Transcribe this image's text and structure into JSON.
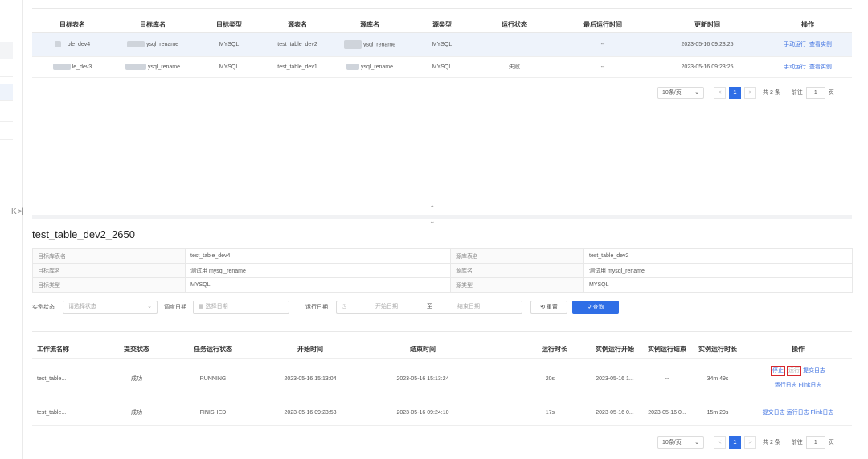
{
  "top_table": {
    "headers": [
      "目标表名",
      "目标库名",
      "目标类型",
      "源表名",
      "源库名",
      "源类型",
      "运行状态",
      "最后运行时间",
      "更新时间",
      "操作"
    ],
    "rows": [
      {
        "target_table": "ble_dev4",
        "target_db": "ysql_rename",
        "target_type": "MYSQL",
        "source_table": "test_table_dev2",
        "source_db": "ysql_rename",
        "source_type": "MYSQL",
        "status": "",
        "last_run": "--",
        "updated": "2023-05-16 09:23:25",
        "action1": "手动运行",
        "action2": "查看实例"
      },
      {
        "target_table": "le_dev3",
        "target_db": "ysql_rename",
        "target_type": "MYSQL",
        "source_table": "test_table_dev1",
        "source_db": "ysql_rename",
        "source_type": "MYSQL",
        "status": "失败",
        "last_run": "--",
        "updated": "2023-05-16 09:23:25",
        "action1": "手动运行",
        "action2": "查看实例"
      }
    ],
    "pager": {
      "page_size": "10条/页",
      "current": "1",
      "total": "共 2 条",
      "goto_label": "前往",
      "goto_value": "1",
      "page_label": "页"
    }
  },
  "collapse_icon": "K >|",
  "splitter": {
    "up": "⌃",
    "down": "⌄"
  },
  "detail": {
    "title": "test_table_dev2_2650",
    "info": [
      {
        "k1": "目标库表名",
        "v1": "test_table_dev4",
        "k2": "源库表名",
        "v2": "test_table_dev2"
      },
      {
        "k1": "目标库名",
        "v1": "测试用 mysql_rename",
        "k2": "源库名",
        "v2": "测试用 mysql_rename"
      },
      {
        "k1": "目标类型",
        "v1": "MYSQL",
        "k2": "源类型",
        "v2": "MYSQL"
      }
    ],
    "filters": {
      "status_label": "实例状态",
      "status_placeholder": "请选择状态",
      "schedule_label": "调度日期",
      "schedule_placeholder": "选择日期",
      "run_label": "运行日期",
      "run_start": "开始日期",
      "run_sep": "至",
      "run_end": "结束日期",
      "reset": "重置",
      "query": "查询"
    },
    "runs_table": {
      "headers": [
        "工作流名称",
        "提交状态",
        "任务运行状态",
        "开始时间",
        "结束时间",
        "运行时长",
        "实例运行开始",
        "实例运行结束",
        "实例运行时长",
        "操作"
      ],
      "rows": [
        {
          "name": "test_table...",
          "submit": "成功",
          "state": "RUNNING",
          "start": "2023-05-16 15:13:04",
          "end": "2023-05-16 15:13:24",
          "duration": "20s",
          "inst_start": "2023-05-16 1...",
          "inst_end": "--",
          "inst_dur": "34m 49s",
          "a_stop": "停止",
          "a_run": "运行",
          "a_submit_log": "提交日志",
          "a_run_log": "运行日志",
          "a_flink_log": "Flink日志"
        },
        {
          "name": "test_table...",
          "submit": "成功",
          "state": "FINISHED",
          "start": "2023-05-16 09:23:53",
          "end": "2023-05-16 09:24:10",
          "duration": "17s",
          "inst_start": "2023-05-16 0...",
          "inst_end": "2023-05-16 0...",
          "inst_dur": "15m 29s",
          "a_submit_log": "提交日志",
          "a_run_log": "运行日志",
          "a_flink_log": "Flink日志"
        }
      ],
      "pager": {
        "page_size": "10条/页",
        "current": "1",
        "total": "共 2 条",
        "goto_label": "前往",
        "goto_value": "1",
        "page_label": "页"
      }
    }
  },
  "colors": {
    "accent": "#2f6ee6",
    "highlight_row": "#eef3fb",
    "red_box": "#d7282d"
  }
}
